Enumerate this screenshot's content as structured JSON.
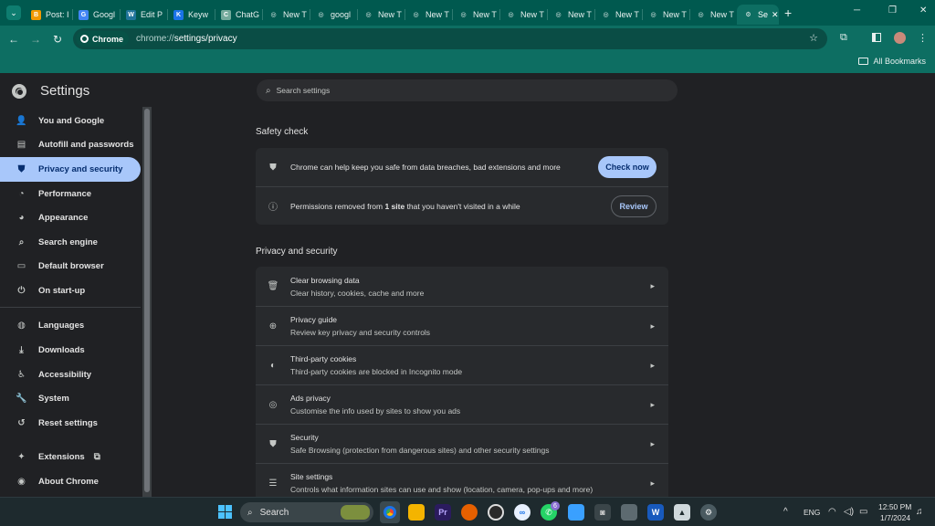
{
  "browser": {
    "tabs": [
      {
        "title": "Post: I",
        "favicon_color": "#f29900",
        "glyph": "B"
      },
      {
        "title": "Googl",
        "favicon_color": "#4285f4",
        "glyph": "G"
      },
      {
        "title": "Edit P",
        "favicon_color": "#21759b",
        "glyph": "W"
      },
      {
        "title": "Keyw",
        "favicon_color": "#1a73e8",
        "glyph": "K"
      },
      {
        "title": "ChatG",
        "favicon_color": "#74aa9c",
        "glyph": "C"
      },
      {
        "title": "New T",
        "favicon_color": "#e8f0ef",
        "glyph": "◎"
      },
      {
        "title": "googl",
        "favicon_color": "#e8f0ef",
        "glyph": "◎"
      },
      {
        "title": "New T",
        "favicon_color": "#e8f0ef",
        "glyph": "◎"
      },
      {
        "title": "New T",
        "favicon_color": "#e8f0ef",
        "glyph": "◎"
      },
      {
        "title": "New T",
        "favicon_color": "#e8f0ef",
        "glyph": "◎"
      },
      {
        "title": "New T",
        "favicon_color": "#e8f0ef",
        "glyph": "◎"
      },
      {
        "title": "New T",
        "favicon_color": "#e8f0ef",
        "glyph": "◎"
      },
      {
        "title": "New T",
        "favicon_color": "#e8f0ef",
        "glyph": "◎"
      },
      {
        "title": "New T",
        "favicon_color": "#e8f0ef",
        "glyph": "◎"
      },
      {
        "title": "New T",
        "favicon_color": "#e8f0ef",
        "glyph": "◎"
      },
      {
        "title": "Se",
        "favicon_color": "#e8f0ef",
        "glyph": "⚙",
        "active": true
      }
    ],
    "omnibox_chip": "Chrome",
    "url_prefix": "chrome://",
    "url_path": "settings/privacy",
    "all_bookmarks": "All Bookmarks"
  },
  "settings": {
    "title": "Settings",
    "search_placeholder": "Search settings",
    "sidebar": [
      {
        "label": "You and Google",
        "icon": "person-icon"
      },
      {
        "label": "Autofill and passwords",
        "icon": "clipboard-icon"
      },
      {
        "label": "Privacy and security",
        "icon": "shield-icon",
        "selected": true
      },
      {
        "label": "Performance",
        "icon": "gauge-icon"
      },
      {
        "label": "Appearance",
        "icon": "palette-icon"
      },
      {
        "label": "Search engine",
        "icon": "search-icon"
      },
      {
        "label": "Default browser",
        "icon": "browser-icon"
      },
      {
        "label": "On start-up",
        "icon": "power-icon"
      },
      {
        "label": "Languages",
        "icon": "globe-icon"
      },
      {
        "label": "Downloads",
        "icon": "download-icon"
      },
      {
        "label": "Accessibility",
        "icon": "accessibility-icon"
      },
      {
        "label": "System",
        "icon": "wrench-icon"
      },
      {
        "label": "Reset settings",
        "icon": "history-icon"
      },
      {
        "label": "Extensions",
        "icon": "puzzle-icon"
      },
      {
        "label": "About Chrome",
        "icon": "chrome-icon"
      }
    ],
    "safety_check": {
      "heading": "Safety check",
      "row1_text": "Chrome can help keep you safe from data breaches, bad extensions and more",
      "check_now": "Check now",
      "row2_before": "Permissions removed from ",
      "row2_bold": "1 site",
      "row2_after": " that you haven't visited in a while",
      "review": "Review"
    },
    "privacy": {
      "heading": "Privacy and security",
      "rows": [
        {
          "title": "Clear browsing data",
          "subtitle": "Clear history, cookies, cache and more",
          "icon": "trash-icon"
        },
        {
          "title": "Privacy guide",
          "subtitle": "Review key privacy and security controls",
          "icon": "compass-icon"
        },
        {
          "title": "Third-party cookies",
          "subtitle": "Third-party cookies are blocked in Incognito mode",
          "icon": "cookie-icon"
        },
        {
          "title": "Ads privacy",
          "subtitle": "Customise the info used by sites to show you ads",
          "icon": "ads-icon"
        },
        {
          "title": "Security",
          "subtitle": "Safe Browsing (protection from dangerous sites) and other security settings",
          "icon": "shield-icon"
        },
        {
          "title": "Site settings",
          "subtitle": "Controls what information sites can use and show (location, camera, pop-ups and more)",
          "icon": "sliders-icon"
        }
      ]
    }
  },
  "taskbar": {
    "search_label": "Search",
    "language": "ENG",
    "time": "12:50 PM",
    "date": "1/7/2024",
    "whatsapp_badge": "6"
  }
}
